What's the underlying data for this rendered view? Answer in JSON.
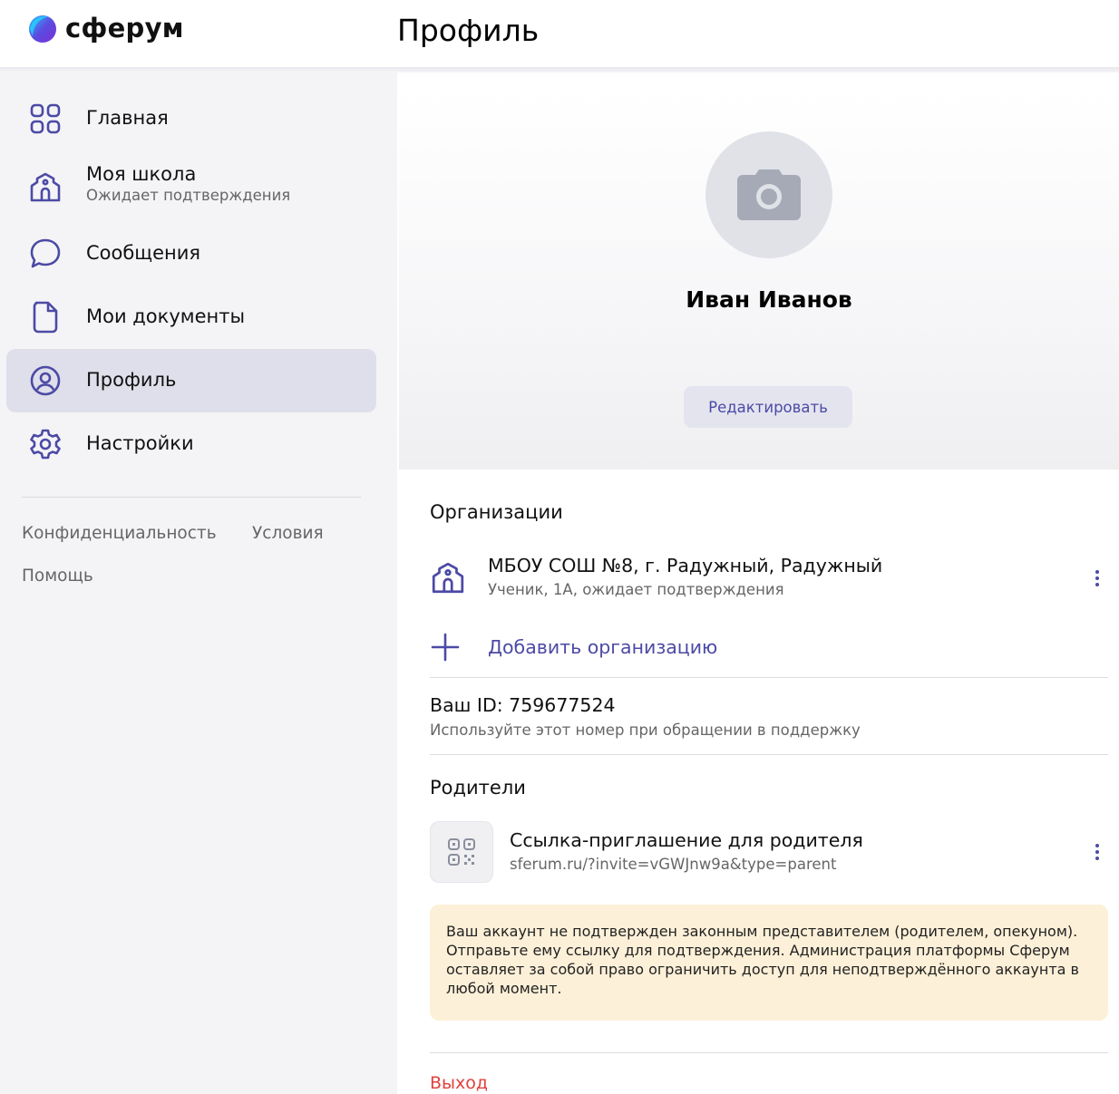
{
  "app": {
    "logo_text": "сферум",
    "page_title": "Профиль"
  },
  "sidebar": {
    "items": [
      {
        "label": "Главная",
        "icon": "apps-grid-icon"
      },
      {
        "label": "Моя школа",
        "sublabel": "Ожидает подтверждения",
        "icon": "school-icon"
      },
      {
        "label": "Сообщения",
        "icon": "message-bubble-icon"
      },
      {
        "label": "Мои документы",
        "icon": "document-icon"
      },
      {
        "label": "Профиль",
        "icon": "user-circle-icon",
        "active": true
      },
      {
        "label": "Настройки",
        "icon": "gear-icon"
      }
    ],
    "footer_links": {
      "privacy": "Конфиденциальность",
      "terms": "Условия",
      "help": "Помощь"
    }
  },
  "profile": {
    "name": "Иван Иванов",
    "edit_label": "Редактировать",
    "avatar_icon": "camera-icon"
  },
  "organizations": {
    "title": "Организации",
    "items": [
      {
        "name": "МБОУ СОШ №8, г. Радужный, Радужный",
        "sub": "Ученик, 1А, ожидает подтверждения"
      }
    ],
    "add_label": "Добавить организацию"
  },
  "account": {
    "id_line": "Ваш ID: 759677524",
    "id_hint": "Используйте этот номер при обращении в поддержку"
  },
  "parents": {
    "title": "Родители",
    "invite_title": "Ссылка-приглашение для родителя",
    "invite_link": "sferum.ru/?invite=vGWJnw9a&type=parent",
    "warning": "Ваш аккаунт не подтвержден законным представителем (родителем, опекуном). Отправьте ему ссылку для подтверждения. Администрация платформы Сферум оставляет за собой право ограничить доступ для неподтверждённого аккаунта в любой момент."
  },
  "logout_label": "Выход",
  "colors": {
    "accent": "#4c4aa5",
    "sidebar_bg": "#f4f4f7",
    "active_item_bg": "#dfdfeb",
    "warning_bg": "#fdf0d8",
    "danger": "#e0413b"
  }
}
